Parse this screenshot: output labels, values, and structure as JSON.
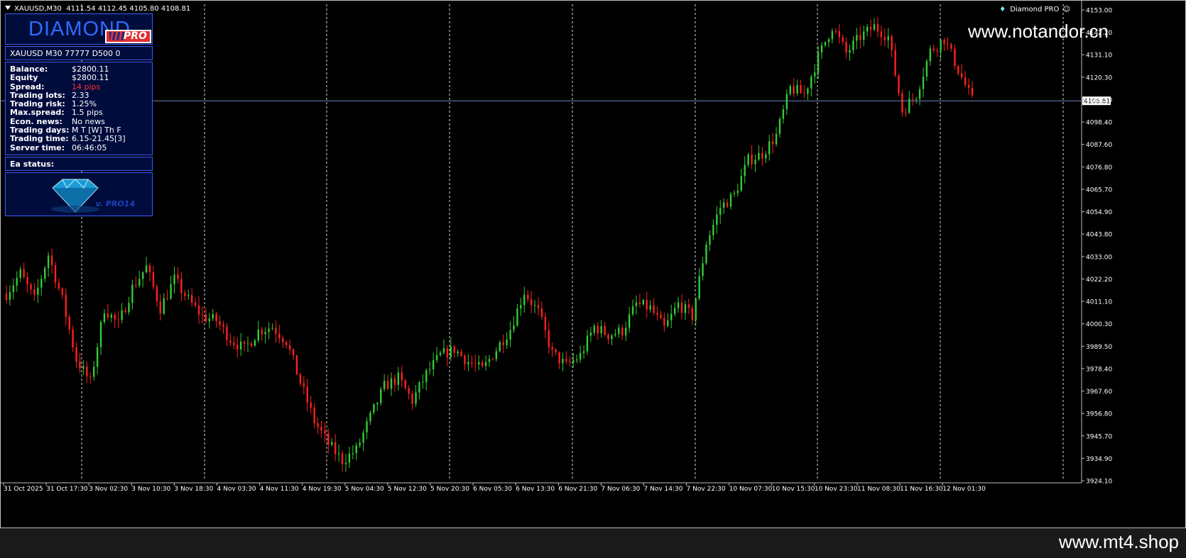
{
  "chart": {
    "symbol": "XAUUSD,M30",
    "ohlc": "4111.54 4112.45 4105.80 4108.81",
    "ea_name": "Diamond PRO",
    "current_price_label": "4108.81",
    "colors": {
      "background": "#000000",
      "bull": "#33cc33",
      "bear": "#ff2020",
      "grid": "#ffffff",
      "price_line": "#6f86b8"
    }
  },
  "chart_data": {
    "type": "candlestick",
    "y_axis_ticks": [
      "4153.00",
      "4142.20",
      "4131.10",
      "4120.30",
      "4109.50",
      "4098.40",
      "4087.60",
      "4076.80",
      "4065.70",
      "4054.90",
      "4043.80",
      "4033.00",
      "4022.20",
      "4011.10",
      "4000.30",
      "3989.50",
      "3978.40",
      "3967.60",
      "3956.80",
      "3945.70",
      "3934.90",
      "3924.10"
    ],
    "ylim": [
      3924.1,
      4153.0
    ],
    "x_axis_ticks": [
      "31 Oct 2025",
      "31 Oct 17:30",
      "3 Nov 02:30",
      "3 Nov 10:30",
      "3 Nov 18:30",
      "4 Nov 03:30",
      "4 Nov 11:30",
      "4 Nov 19:30",
      "5 Nov 04:30",
      "5 Nov 12:30",
      "5 Nov 20:30",
      "6 Nov 05:30",
      "6 Nov 13:30",
      "6 Nov 21:30",
      "7 Nov 06:30",
      "7 Nov 14:30",
      "7 Nov 22:30",
      "10 Nov 07:30",
      "10 Nov 15:30",
      "10 Nov 23:30",
      "11 Nov 08:30",
      "11 Nov 16:30",
      "12 Nov 01:30"
    ],
    "price_path": [
      [
        0,
        4015
      ],
      [
        4,
        4025
      ],
      [
        8,
        4012
      ],
      [
        12,
        4034
      ],
      [
        16,
        4012
      ],
      [
        20,
        3983
      ],
      [
        24,
        3972
      ],
      [
        28,
        4008
      ],
      [
        32,
        4000
      ],
      [
        36,
        4018
      ],
      [
        40,
        4028
      ],
      [
        44,
        4008
      ],
      [
        48,
        4022
      ],
      [
        52,
        4012
      ],
      [
        56,
        4004
      ],
      [
        60,
        4002
      ],
      [
        64,
        3993
      ],
      [
        68,
        3988
      ],
      [
        72,
        3997
      ],
      [
        76,
        3999
      ],
      [
        80,
        3992
      ],
      [
        84,
        3972
      ],
      [
        88,
        3953
      ],
      [
        92,
        3942
      ],
      [
        96,
        3934
      ],
      [
        100,
        3939
      ],
      [
        104,
        3955
      ],
      [
        108,
        3970
      ],
      [
        112,
        3974
      ],
      [
        116,
        3963
      ],
      [
        120,
        3976
      ],
      [
        124,
        3985
      ],
      [
        128,
        3988
      ],
      [
        132,
        3982
      ],
      [
        136,
        3978
      ],
      [
        140,
        3988
      ],
      [
        144,
        3998
      ],
      [
        148,
        4016
      ],
      [
        152,
        4006
      ],
      [
        156,
        3986
      ],
      [
        160,
        3980
      ],
      [
        164,
        3985
      ],
      [
        168,
        3999
      ],
      [
        172,
        3995
      ],
      [
        176,
        3997
      ],
      [
        180,
        4010
      ],
      [
        184,
        4008
      ],
      [
        188,
        3998
      ],
      [
        192,
        4010
      ],
      [
        196,
        4004
      ],
      [
        200,
        4040
      ],
      [
        204,
        4057
      ],
      [
        208,
        4063
      ],
      [
        212,
        4080
      ],
      [
        216,
        4083
      ],
      [
        220,
        4092
      ],
      [
        224,
        4115
      ],
      [
        228,
        4112
      ],
      [
        232,
        4130
      ],
      [
        236,
        4145
      ],
      [
        240,
        4132
      ],
      [
        244,
        4140
      ],
      [
        248,
        4145
      ],
      [
        252,
        4140
      ],
      [
        256,
        4104
      ],
      [
        260,
        4112
      ],
      [
        264,
        4133
      ],
      [
        268,
        4139
      ],
      [
        272,
        4124
      ],
      [
        276,
        4108.81
      ]
    ],
    "current_price": 4108.81
  },
  "ea_panel": {
    "logo_text": "DIAMOND",
    "logo_badge": "PRO",
    "account_line": "XAUUSD M30 77777  D500 0",
    "stats": [
      {
        "label": "Balance:",
        "value": "$2800.11",
        "color": "#ffffff"
      },
      {
        "label": "Equity",
        "value": "$2800.11",
        "color": "#ffffff"
      },
      {
        "label": "Spread:",
        "value": "14 pips",
        "color": "#ff3030"
      },
      {
        "label": "Trading lots:",
        "value": "2.33",
        "color": "#ffffff"
      },
      {
        "label": "Trading risk:",
        "value": "1.25%",
        "color": "#ffffff"
      },
      {
        "label": "Max.spread:",
        "value": "1.5 pips",
        "color": "#ffffff"
      },
      {
        "label": "Econ. news:",
        "value": "No news",
        "color": "#ffffff"
      },
      {
        "label": "Trading days:",
        "value": "M T [W] Th F",
        "color": "#ffffff"
      },
      {
        "label": "Trading time:",
        "value": "6.15-21.45[3]",
        "color": "#ffffff"
      },
      {
        "label": "Server time:",
        "value": "06:46:05",
        "color": "#ffffff"
      }
    ],
    "status_label": "Ea status:",
    "version": "v. PRO14"
  },
  "watermarks": {
    "top": "www.notandor.cn",
    "bottom": "www.mt4.shop"
  }
}
